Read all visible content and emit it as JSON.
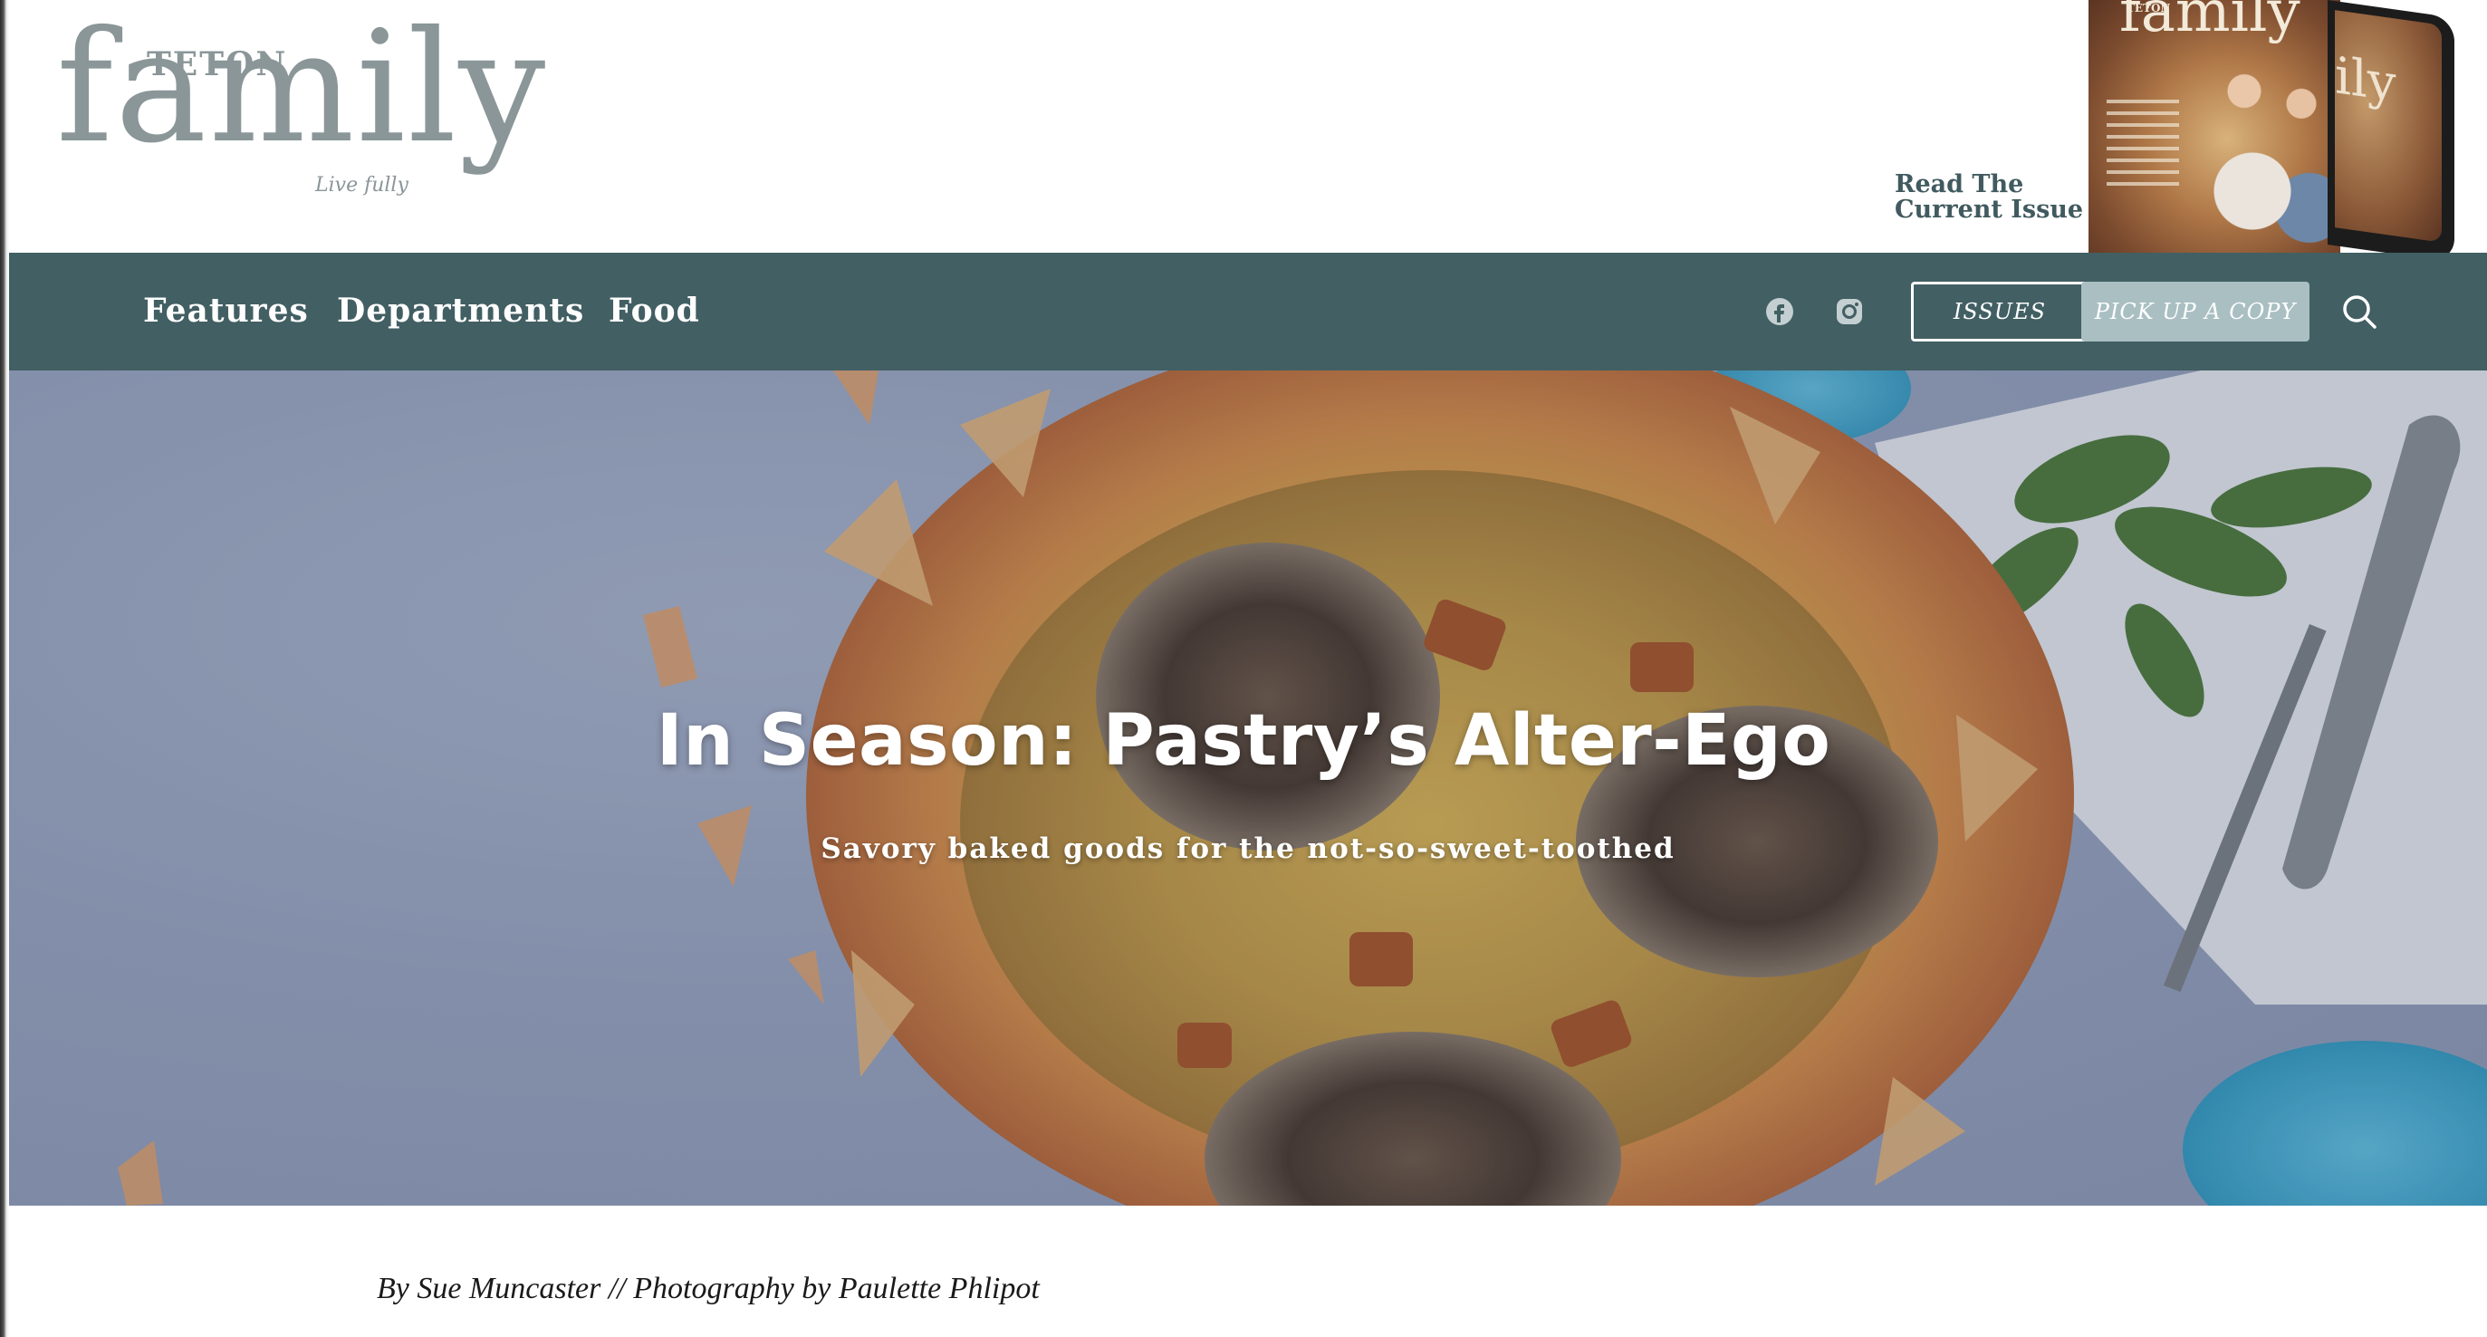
{
  "header": {
    "logo": {
      "top_text": "TETON",
      "main_text": "family",
      "tagline": "Live fully"
    },
    "read_issue_line1": "Read The",
    "read_issue_line2": "Current Issue",
    "cover": {
      "title": "family",
      "small": "TETON"
    },
    "tablet_text": "ily"
  },
  "nav": {
    "links": [
      {
        "label": "Features"
      },
      {
        "label": "Departments"
      },
      {
        "label": "Food"
      }
    ],
    "social": [
      "facebook-icon",
      "instagram-icon"
    ],
    "issues_label": "ISSUES",
    "pickup_label": "PICK UP A COPY",
    "search_icon": "search-icon"
  },
  "hero": {
    "title": "In Season: Pastry’s Alter-Ego",
    "subtitle": "Savory baked goods for the not-so-sweet-toothed"
  },
  "article": {
    "byline": "By Sue Muncaster // Photography by Paulette Phlipot"
  },
  "colors": {
    "nav_bg": "#425f63",
    "logo": "#8a9698",
    "read_issue": "#415a5f",
    "pickup_bg": "#a9bfc2"
  }
}
